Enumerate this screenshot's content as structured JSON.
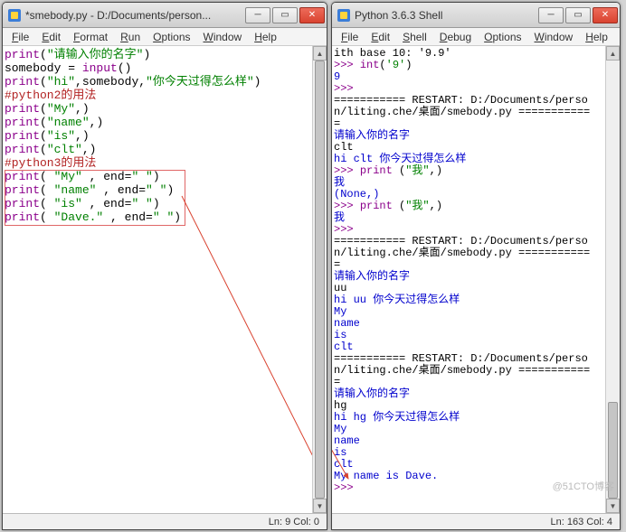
{
  "editor": {
    "title": "*smebody.py - D:/Documents/person...",
    "menus": [
      "File",
      "Edit",
      "Format",
      "Run",
      "Options",
      "Window",
      "Help"
    ],
    "code_lines": [
      {
        "segs": [
          [
            "fn",
            "print"
          ],
          [
            "p",
            "("
          ],
          [
            "str",
            "\"请输入你的名字\""
          ],
          [
            "p",
            ")"
          ]
        ]
      },
      {
        "segs": [
          [
            "p",
            "somebody = "
          ],
          [
            "fn",
            "input"
          ],
          [
            "p",
            "()"
          ]
        ]
      },
      {
        "segs": [
          [
            "fn",
            "print"
          ],
          [
            "p",
            "("
          ],
          [
            "str",
            "\"hi\""
          ],
          [
            "p",
            ",somebody,"
          ],
          [
            "str",
            "\"你今天过得怎么样\""
          ],
          [
            "p",
            ")"
          ]
        ]
      },
      {
        "segs": [
          [
            "cmt",
            "#python2的用法"
          ]
        ]
      },
      {
        "segs": [
          [
            "fn",
            "print"
          ],
          [
            "p",
            "("
          ],
          [
            "str",
            "\"My\""
          ],
          [
            "p",
            ",)"
          ]
        ]
      },
      {
        "segs": [
          [
            "fn",
            "print"
          ],
          [
            "p",
            "("
          ],
          [
            "str",
            "\"name\""
          ],
          [
            "p",
            ",)"
          ]
        ]
      },
      {
        "segs": [
          [
            "fn",
            "print"
          ],
          [
            "p",
            "("
          ],
          [
            "str",
            "\"is\""
          ],
          [
            "p",
            ",)"
          ]
        ]
      },
      {
        "segs": [
          [
            "fn",
            "print"
          ],
          [
            "p",
            "("
          ],
          [
            "str",
            "\"clt\""
          ],
          [
            "p",
            ",)"
          ]
        ]
      },
      {
        "segs": [
          [
            "cmt",
            "#python3的用法"
          ]
        ]
      },
      {
        "segs": [
          [
            "fn",
            "print"
          ],
          [
            "p",
            "( "
          ],
          [
            "str",
            "\"My\""
          ],
          [
            "p",
            " , end="
          ],
          [
            "str",
            "\" \""
          ],
          [
            "p",
            ")"
          ]
        ]
      },
      {
        "segs": [
          [
            "fn",
            "print"
          ],
          [
            "p",
            "( "
          ],
          [
            "str",
            "\"name\""
          ],
          [
            "p",
            " , end="
          ],
          [
            "str",
            "\" \""
          ],
          [
            "p",
            ")"
          ]
        ]
      },
      {
        "segs": [
          [
            "fn",
            "print"
          ],
          [
            "p",
            "( "
          ],
          [
            "str",
            "\"is\""
          ],
          [
            "p",
            " , end="
          ],
          [
            "str",
            "\" \""
          ],
          [
            "p",
            ")"
          ]
        ]
      },
      {
        "segs": [
          [
            "fn",
            "print"
          ],
          [
            "p",
            "( "
          ],
          [
            "str",
            "\"Dave.\""
          ],
          [
            "p",
            " , end="
          ],
          [
            "str",
            "\" \""
          ],
          [
            "p",
            ")"
          ]
        ]
      }
    ],
    "status": "Ln: 9  Col: 0"
  },
  "shell": {
    "title": "Python 3.6.3 Shell",
    "menus": [
      "File",
      "Edit",
      "Shell",
      "Debug",
      "Options",
      "Window",
      "Help"
    ],
    "lines": [
      {
        "segs": [
          [
            "p",
            "ith base 10: '9.9'"
          ]
        ]
      },
      {
        "segs": [
          [
            "purple",
            ">>> "
          ],
          [
            "fn",
            "int"
          ],
          [
            "p",
            "("
          ],
          [
            "str",
            "'9'"
          ],
          [
            "p",
            ")"
          ]
        ]
      },
      {
        "segs": [
          [
            "blue",
            "9"
          ]
        ]
      },
      {
        "segs": [
          [
            "purple",
            ">>> "
          ]
        ]
      },
      {
        "segs": [
          [
            "p",
            "=========== RESTART: D:/Documents/perso"
          ]
        ]
      },
      {
        "segs": [
          [
            "p",
            "n/liting.che/桌面/smebody.py ==========="
          ]
        ]
      },
      {
        "segs": [
          [
            "p",
            "="
          ]
        ]
      },
      {
        "segs": [
          [
            "blue",
            "请输入你的名字"
          ]
        ]
      },
      {
        "segs": [
          [
            "p",
            "clt"
          ]
        ]
      },
      {
        "segs": [
          [
            "blue",
            "hi clt 你今天过得怎么样"
          ]
        ]
      },
      {
        "segs": [
          [
            "purple",
            ">>> "
          ],
          [
            "fn",
            "print"
          ],
          [
            "p",
            " ("
          ],
          [
            "str",
            "\"我\""
          ],
          [
            "p",
            ",)"
          ]
        ]
      },
      {
        "segs": [
          [
            "blue",
            "我"
          ]
        ]
      },
      {
        "segs": [
          [
            "blue",
            "(None,)"
          ]
        ]
      },
      {
        "segs": [
          [
            "purple",
            ">>> "
          ],
          [
            "fn",
            "print"
          ],
          [
            "p",
            " ("
          ],
          [
            "str",
            "\"我\""
          ],
          [
            "p",
            ",)"
          ]
        ]
      },
      {
        "segs": [
          [
            "blue",
            "我"
          ]
        ]
      },
      {
        "segs": [
          [
            "purple",
            ">>> "
          ]
        ]
      },
      {
        "segs": [
          [
            "p",
            "=========== RESTART: D:/Documents/perso"
          ]
        ]
      },
      {
        "segs": [
          [
            "p",
            "n/liting.che/桌面/smebody.py ==========="
          ]
        ]
      },
      {
        "segs": [
          [
            "p",
            "="
          ]
        ]
      },
      {
        "segs": [
          [
            "blue",
            "请输入你的名字"
          ]
        ]
      },
      {
        "segs": [
          [
            "p",
            "uu"
          ]
        ]
      },
      {
        "segs": [
          [
            "blue",
            "hi uu 你今天过得怎么样"
          ]
        ]
      },
      {
        "segs": [
          [
            "blue",
            "My"
          ]
        ]
      },
      {
        "segs": [
          [
            "blue",
            "name"
          ]
        ]
      },
      {
        "segs": [
          [
            "blue",
            "is"
          ]
        ]
      },
      {
        "segs": [
          [
            "blue",
            "clt"
          ]
        ]
      },
      {
        "segs": [
          [
            "p",
            "=========== RESTART: D:/Documents/perso"
          ]
        ]
      },
      {
        "segs": [
          [
            "p",
            "n/liting.che/桌面/smebody.py ==========="
          ]
        ]
      },
      {
        "segs": [
          [
            "p",
            "="
          ]
        ]
      },
      {
        "segs": [
          [
            "blue",
            "请输入你的名字"
          ]
        ]
      },
      {
        "segs": [
          [
            "p",
            "hg"
          ]
        ]
      },
      {
        "segs": [
          [
            "blue",
            "hi hg 你今天过得怎么样"
          ]
        ]
      },
      {
        "segs": [
          [
            "blue",
            "My"
          ]
        ]
      },
      {
        "segs": [
          [
            "blue",
            "name"
          ]
        ]
      },
      {
        "segs": [
          [
            "blue",
            "is"
          ]
        ]
      },
      {
        "segs": [
          [
            "blue",
            "clt"
          ]
        ]
      },
      {
        "segs": [
          [
            "blue",
            "My name is Dave. "
          ]
        ]
      },
      {
        "segs": [
          [
            "purple",
            ">>> "
          ]
        ]
      }
    ],
    "status": "Ln: 163  Col: 4"
  },
  "win_buttons": {
    "min": "─",
    "max": "▭",
    "close": "✕"
  },
  "watermark": "@51CTO博客"
}
